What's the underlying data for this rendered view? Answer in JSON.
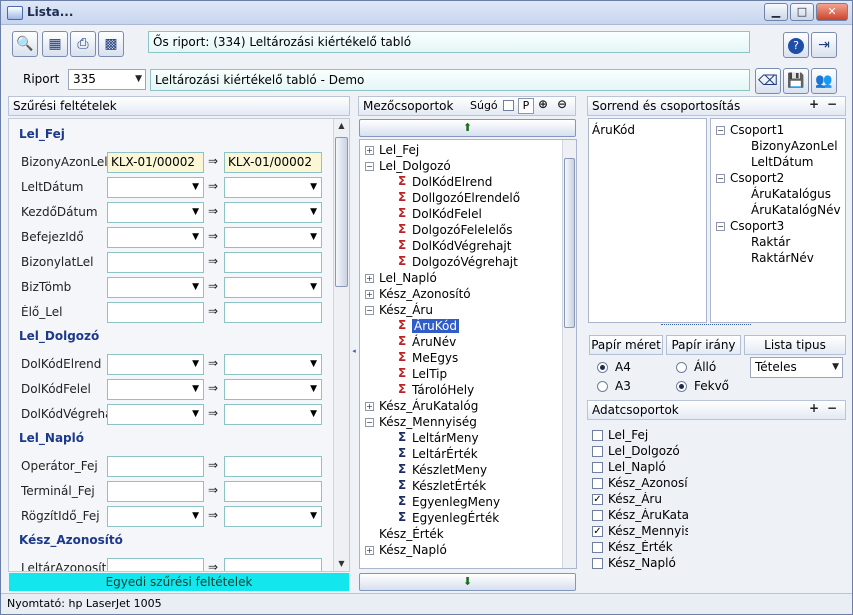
{
  "window": {
    "title": "Lista..."
  },
  "toolbar": {
    "origin_report": "Ős riport: (334)  Leltározási kiértékelő tabló"
  },
  "report": {
    "label": "Riport",
    "number": "335",
    "name": "Leltározási kiértékelő tabló - Demo"
  },
  "filters": {
    "header": "Szűrési feltételek",
    "sections": [
      {
        "title": "Lel_Fej",
        "rows": [
          {
            "label": "BizonyAzonLel",
            "from": "KLX-01/00002",
            "to": "KLX-01/00002",
            "dropdown": false,
            "filled": true
          },
          {
            "label": "LeltDátum",
            "from": "",
            "to": "",
            "dropdown": true
          },
          {
            "label": "KezdőDátum",
            "from": "",
            "to": "",
            "dropdown": true
          },
          {
            "label": "BefejezIdő",
            "from": "",
            "to": "",
            "dropdown": true
          },
          {
            "label": "BizonylatLel",
            "from": "",
            "to": "",
            "dropdown": false
          },
          {
            "label": "BizTömb",
            "from": "",
            "to": "",
            "dropdown": true
          },
          {
            "label": "Élő_Lel",
            "from": "",
            "to": "",
            "dropdown": false
          }
        ]
      },
      {
        "title": "Lel_Dolgozó",
        "rows": [
          {
            "label": "DolKódElrend",
            "from": "",
            "to": "",
            "dropdown": true
          },
          {
            "label": "DolKódFelel",
            "from": "",
            "to": "",
            "dropdown": true
          },
          {
            "label": "DolKódVégrehajt",
            "from": "",
            "to": "",
            "dropdown": true
          }
        ]
      },
      {
        "title": "Lel_Napló",
        "rows": [
          {
            "label": "Operátor_Fej",
            "from": "",
            "to": "",
            "dropdown": false
          },
          {
            "label": "Terminál_Fej",
            "from": "",
            "to": "",
            "dropdown": false
          },
          {
            "label": "RögzítIdő_Fej",
            "from": "",
            "to": "",
            "dropdown": true
          }
        ]
      },
      {
        "title": "Kész_Azonosító",
        "rows": [
          {
            "label": "LeltárAzonosító",
            "from": "",
            "to": "",
            "dropdown": false
          }
        ]
      }
    ],
    "custom_button": "Egyedi szűrési feltételek"
  },
  "fieldgroups": {
    "header": "Mezőcsoportok",
    "help_label": "Súgó",
    "p_label": "P",
    "tree": [
      {
        "level": 0,
        "text": "Lel_Fej",
        "toggle": "+"
      },
      {
        "level": 0,
        "text": "Lel_Dolgozó",
        "toggle": "-"
      },
      {
        "level": 1,
        "text": "DolKódElrend",
        "icon": "sigma-red"
      },
      {
        "level": 1,
        "text": "DollgozóElrendelő",
        "icon": "sigma-red"
      },
      {
        "level": 1,
        "text": "DolKódFelel",
        "icon": "sigma-red"
      },
      {
        "level": 1,
        "text": "DolgozóFelelelős",
        "icon": "sigma-red"
      },
      {
        "level": 1,
        "text": "DolKódVégrehajt",
        "icon": "sigma-red"
      },
      {
        "level": 1,
        "text": "DolgozóVégrehajt",
        "icon": "sigma-red"
      },
      {
        "level": 0,
        "text": "Lel_Napló",
        "toggle": "+"
      },
      {
        "level": 0,
        "text": "Kész_Azonosító",
        "toggle": "+"
      },
      {
        "level": 0,
        "text": "Kész_Áru",
        "toggle": "-"
      },
      {
        "level": 1,
        "text": "ÁruKód",
        "icon": "sigma-red",
        "selected": true
      },
      {
        "level": 1,
        "text": "ÁruNév",
        "icon": "sigma-red"
      },
      {
        "level": 1,
        "text": "MeEgys",
        "icon": "sigma-red"
      },
      {
        "level": 1,
        "text": "LelTip",
        "icon": "sigma-red"
      },
      {
        "level": 1,
        "text": "TárolóHely",
        "icon": "sigma-red"
      },
      {
        "level": 0,
        "text": "Kész_ÁruKatalóg",
        "toggle": "+"
      },
      {
        "level": 0,
        "text": "Kész_Mennyiség",
        "toggle": "-"
      },
      {
        "level": 1,
        "text": "LeltárMeny",
        "icon": "sigma-blue"
      },
      {
        "level": 1,
        "text": "LeltárÉrték",
        "icon": "sigma-blue"
      },
      {
        "level": 1,
        "text": "KészletMeny",
        "icon": "sigma-blue"
      },
      {
        "level": 1,
        "text": "KészletÉrték",
        "icon": "sigma-blue"
      },
      {
        "level": 1,
        "text": "EgyenlegMeny",
        "icon": "sigma-blue"
      },
      {
        "level": 1,
        "text": "EgyenlegÉrték",
        "icon": "sigma-blue"
      },
      {
        "level": 0,
        "text": "Kész_Érték",
        "toggle": ""
      },
      {
        "level": 0,
        "text": "Kész_Napló",
        "toggle": "+"
      }
    ]
  },
  "order": {
    "header": "Sorrend és csoportosítás",
    "sort_items": [
      "ÁruKód"
    ],
    "groups": [
      {
        "name": "Csoport1",
        "items": [
          "BizonyAzonLel",
          "LeltDátum"
        ]
      },
      {
        "name": "Csoport2",
        "items": [
          "ÁruKatalógus",
          "ÁruKatalógNév"
        ]
      },
      {
        "name": "Csoport3",
        "items": [
          "Raktár",
          "RaktárNév"
        ]
      }
    ]
  },
  "paper": {
    "size_label": "Papír méret",
    "orientation_label": "Papír irány",
    "list_type_label": "Lista tipus",
    "size_a4": "A4",
    "size_a3": "A3",
    "orient_portrait": "Álló",
    "orient_landscape": "Fekvő",
    "list_type_value": "Tételes"
  },
  "datagroups": {
    "header": "Adatcsoportok",
    "items": [
      {
        "text": "Lel_Fej",
        "checked": false
      },
      {
        "text": "Lel_Dolgozó",
        "checked": false
      },
      {
        "text": "Lel_Napló",
        "checked": false
      },
      {
        "text": "Kész_Azonosító",
        "checked": false
      },
      {
        "text": "Kész_Áru",
        "checked": true
      },
      {
        "text": "Kész_ÁruKatalóg",
        "checked": false
      },
      {
        "text": "Kész_Mennyiség",
        "checked": true
      },
      {
        "text": "Kész_Érték",
        "checked": false
      },
      {
        "text": "Kész_Napló",
        "checked": false
      }
    ]
  },
  "status": {
    "printer": "Nyomtató: hp LaserJet 1005"
  }
}
